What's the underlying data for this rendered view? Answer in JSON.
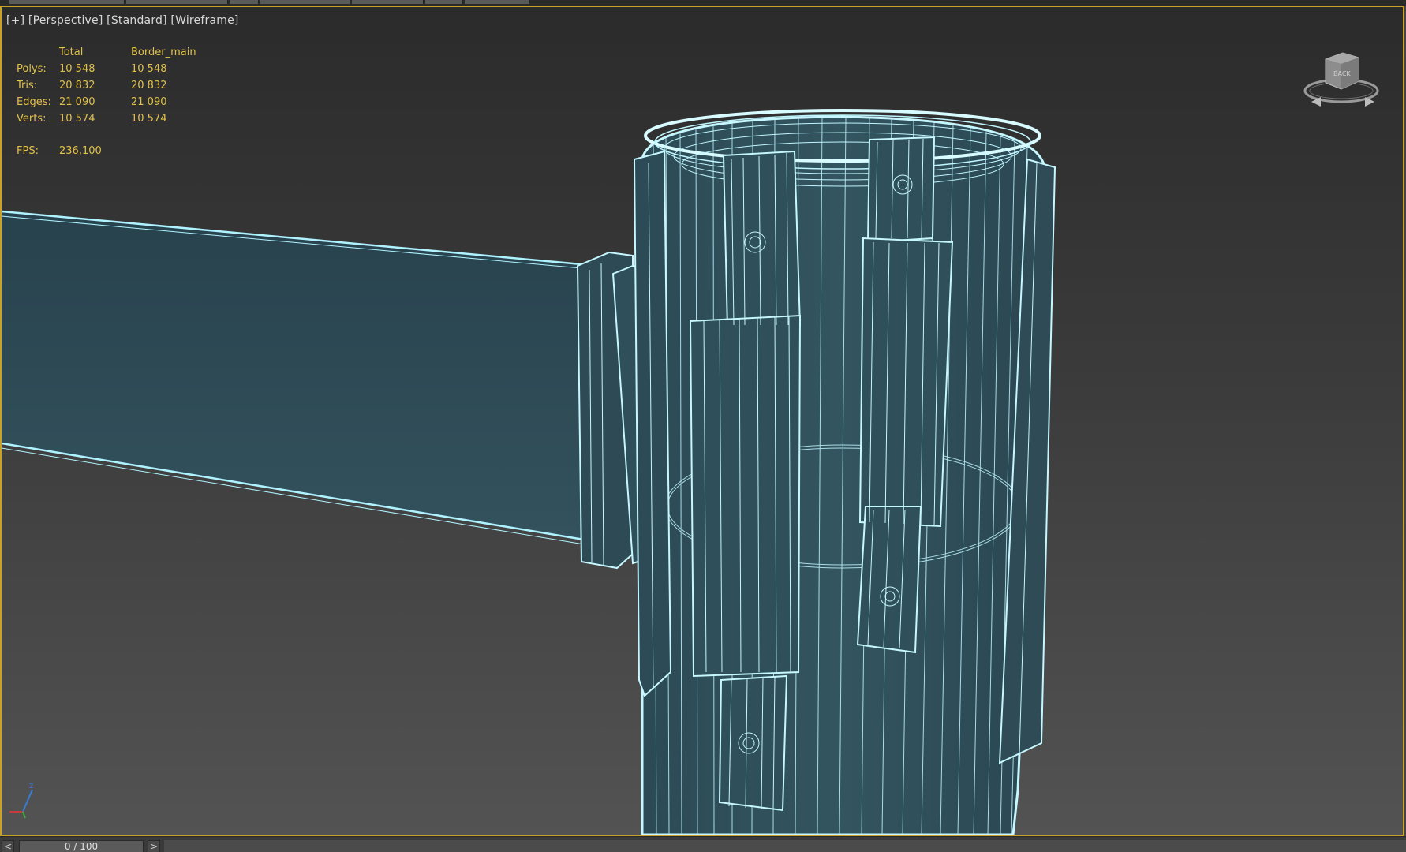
{
  "viewport": {
    "label": "[+] [Perspective] [Standard] [Wireframe]",
    "active_border_color": "#c9a227",
    "wire_color": "#aef3ff"
  },
  "stats": {
    "header_total": "Total",
    "header_object": "Border_main",
    "rows": [
      {
        "label": "Polys:",
        "total": "10 548",
        "object": "10 548"
      },
      {
        "label": "Tris:",
        "total": "20 832",
        "object": "20 832"
      },
      {
        "label": "Edges:",
        "total": "21 090",
        "object": "21 090"
      },
      {
        "label": "Verts:",
        "total": "10 574",
        "object": "10 574"
      }
    ],
    "fps_label": "FPS:",
    "fps_value": "236,100",
    "text_color": "#e2c14a"
  },
  "viewcube": {
    "face_label": "BACK",
    "icon": "viewcube-icon"
  },
  "axis": {
    "icon": "axis-tripod-icon",
    "z_label": "z"
  },
  "timeline": {
    "prev_label": "<",
    "slider_label": "0 / 100",
    "next_label": ">"
  }
}
